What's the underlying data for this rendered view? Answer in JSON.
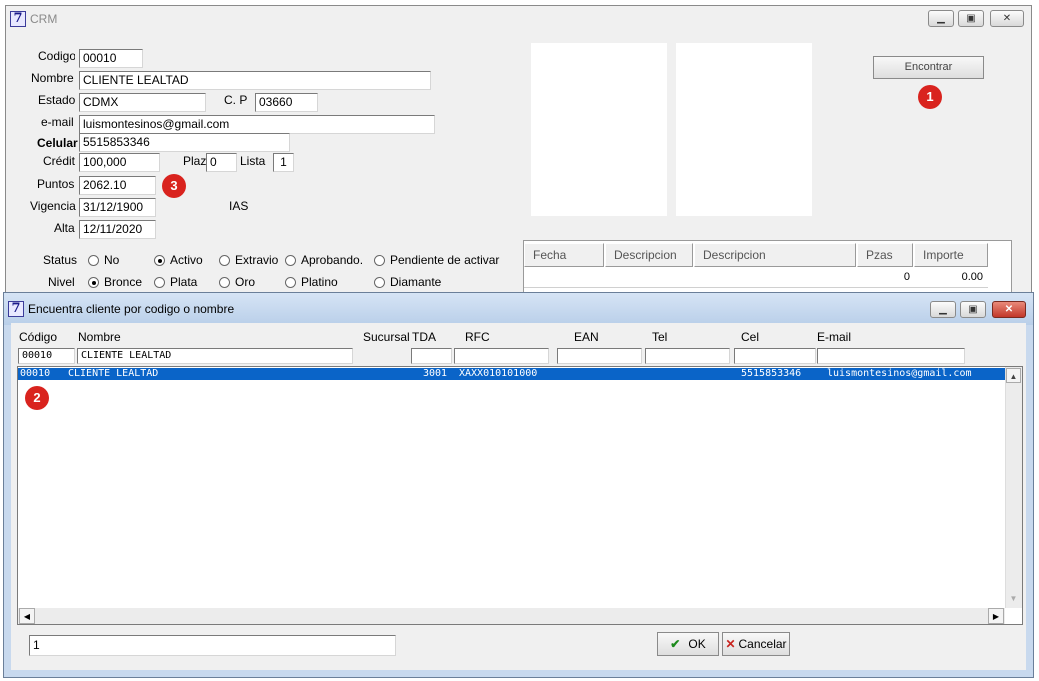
{
  "main_window": {
    "title": "CRM",
    "fields": {
      "codigo": {
        "label": "Codigo",
        "value": "00010"
      },
      "nombre": {
        "label": "Nombre",
        "value": "CLIENTE LEALTAD"
      },
      "estado": {
        "label": "Estado",
        "value": "CDMX"
      },
      "cp": {
        "label": "C. P",
        "value": "03660"
      },
      "email": {
        "label": "e-mail",
        "value": "luismontesinos@gmail.com"
      },
      "celular": {
        "label": "Celular",
        "value": "5515853346"
      },
      "credito": {
        "label": "Crédit",
        "value": "100,000"
      },
      "plazo": {
        "label": "Plaz",
        "value": "0"
      },
      "lista": {
        "label": "Lista",
        "value": "1"
      },
      "puntos": {
        "label": "Puntos",
        "value": "2062.10"
      },
      "vigencia": {
        "label": "Vigencia",
        "value": "31/12/1900"
      },
      "alta": {
        "label": "Alta",
        "value": "12/11/2020"
      }
    },
    "ias_label": "IAS",
    "status": {
      "label": "Status",
      "options": [
        "No",
        "Activo",
        "Extravio",
        "Aprobando.",
        "Pendiente de activar"
      ],
      "selected": "Activo"
    },
    "nivel": {
      "label": "Nivel",
      "options": [
        "Bronce",
        "Plata",
        "Oro",
        "Platino",
        "Diamante"
      ],
      "selected": "Bronce"
    },
    "encontrar_button": "Encontrar",
    "grid": {
      "headers": [
        "Fecha",
        "Descripcion",
        "Descripcion",
        "Pzas",
        "Importe"
      ],
      "row": {
        "pzas": "0",
        "importe": "0.00"
      }
    }
  },
  "dialog": {
    "title": "Encuentra cliente por codigo o nombre",
    "columns": [
      "Código",
      "Nombre",
      "Sucursal",
      "TDA",
      "RFC",
      "EAN",
      "Tel",
      "Cel",
      "E-mail"
    ],
    "filters": {
      "codigo": "00010",
      "nombre": "CLIENTE LEALTAD"
    },
    "result": {
      "codigo": "00010",
      "nombre": "CLIENTE LEALTAD",
      "tda": "3001",
      "rfc": "XAXX010101000",
      "cel": "5515853346",
      "email": "luismontesinos@gmail.com"
    },
    "bottom_field": "1",
    "ok_label": "OK",
    "cancel_label": "Cancelar"
  },
  "annotations": {
    "b1": "1",
    "b2": "2",
    "b3": "3"
  },
  "colors": {
    "selection": "#0a64c8",
    "badge": "#d9231e",
    "window_bg": "#f0f0f0"
  }
}
